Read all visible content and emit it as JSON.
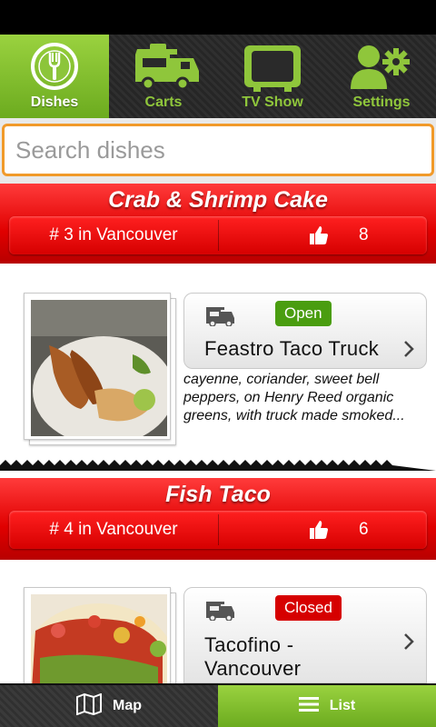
{
  "nav": {
    "tabs": [
      {
        "label": "Dishes",
        "icon": "fork-plate-icon",
        "active": true
      },
      {
        "label": "Carts",
        "icon": "food-truck-icon",
        "active": false
      },
      {
        "label": "TV Show",
        "icon": "tv-icon",
        "active": false
      },
      {
        "label": "Settings",
        "icon": "user-gear-icon",
        "active": false
      }
    ]
  },
  "search": {
    "placeholder": "Search dishes",
    "value": ""
  },
  "dishes": [
    {
      "title": "Crab & Shrimp Cake",
      "rank": "# 3 in Vancouver",
      "likes": "8",
      "cart": {
        "name": "Feastro Taco Truck",
        "status": "Open"
      },
      "description": "cayenne, coriander, sweet bell\npeppers, on Henry Reed organic\ngreens, with truck made smoked..."
    },
    {
      "title": "Fish Taco",
      "rank": "# 4 in Vancouver",
      "likes": "6",
      "cart": {
        "name": "Tacofino -\nVancouver",
        "status": "Closed"
      }
    }
  ],
  "bottom": {
    "map_label": "Map",
    "list_label": "List"
  },
  "colors": {
    "accent_green": "#7dbb2c",
    "header_red": "#e00000",
    "open_green": "#4a9d10",
    "closed_red": "#d60000",
    "search_border": "#f19a2a"
  }
}
